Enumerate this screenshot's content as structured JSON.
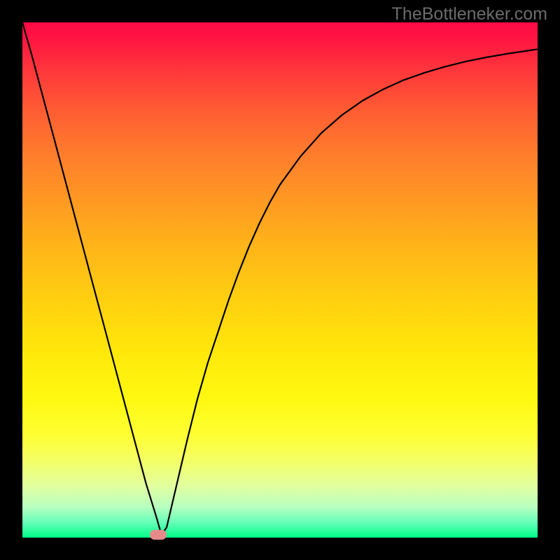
{
  "watermark": "TheBottleneker.com",
  "chart_data": {
    "type": "line",
    "title": "",
    "xlabel": "",
    "ylabel": "",
    "xlim": [
      0,
      100
    ],
    "ylim": [
      0,
      100
    ],
    "x": [
      0,
      2,
      4,
      6,
      8,
      10,
      12,
      14,
      16,
      18,
      20,
      22,
      24,
      26,
      27,
      28,
      30,
      32,
      34,
      36,
      38,
      40,
      42,
      44,
      46,
      48,
      50,
      54,
      58,
      62,
      66,
      70,
      74,
      78,
      82,
      86,
      90,
      94,
      98,
      100
    ],
    "values": [
      100,
      93,
      85.5,
      78,
      70.5,
      63,
      55.5,
      48,
      40.5,
      33,
      25.5,
      18,
      10.5,
      4,
      0.5,
      2,
      10.5,
      19,
      27,
      34,
      40,
      46,
      51.5,
      56.5,
      61,
      65,
      68.5,
      74,
      78.5,
      82,
      84.8,
      87,
      88.8,
      90.2,
      91.4,
      92.4,
      93.2,
      93.9,
      94.5,
      94.8
    ],
    "marker": {
      "x": 26.3,
      "y": 0.5
    },
    "gradient_stops": [
      {
        "pos": 0,
        "color": "#ff0a46"
      },
      {
        "pos": 10,
        "color": "#ff3a3a"
      },
      {
        "pos": 26,
        "color": "#ff7e2c"
      },
      {
        "pos": 44,
        "color": "#ffb618"
      },
      {
        "pos": 64,
        "color": "#ffe80a"
      },
      {
        "pos": 80,
        "color": "#feff32"
      },
      {
        "pos": 90,
        "color": "#e2ffa0"
      },
      {
        "pos": 97,
        "color": "#68ffb8"
      },
      {
        "pos": 100,
        "color": "#00ff88"
      }
    ]
  }
}
